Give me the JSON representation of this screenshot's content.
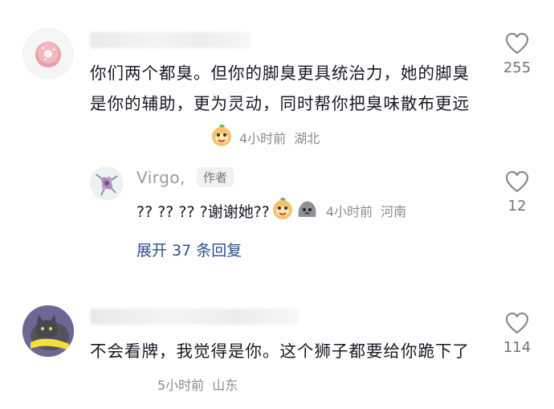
{
  "comments": [
    {
      "text": "你们两个都臭。但你的脚臭更具统治力，她的脚臭是你的辅助，更为灵动，同时帮你把臭味散布更远",
      "time": "4小时前",
      "location": "湖北",
      "likes": "255",
      "reply": {
        "user": "Virgo,",
        "badge": "作者",
        "text": "?? ?? ?? ?谢谢她??",
        "time": "4小时前",
        "location": "河南",
        "likes": "12"
      },
      "expand_label": "展开 37 条回复"
    },
    {
      "text": "不会看牌，我觉得是你。这个狮子都要给你跪下了",
      "time": "5小时前",
      "location": "山东",
      "likes": "114"
    }
  ],
  "icons": {
    "like": "heart-outline-icon"
  }
}
